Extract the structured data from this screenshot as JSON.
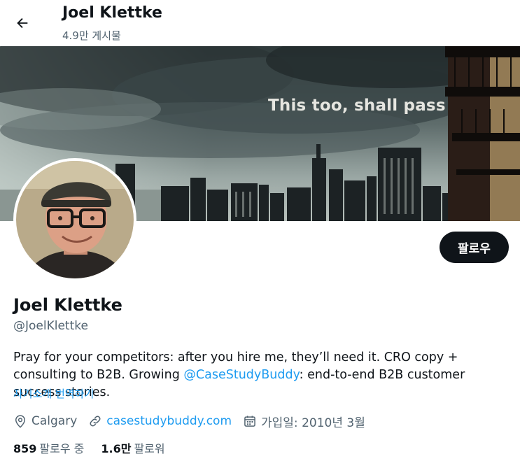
{
  "header": {
    "title": "Joel Klettke",
    "post_count": "4.9만 게시물",
    "back_icon": "arrow-left-icon"
  },
  "banner": {
    "text": "This too, shall pass"
  },
  "profile": {
    "name": "Joel Klettke",
    "handle": "@JoelKlettke",
    "follow_label": "팔로우",
    "bio_before": "Pray for your competitors: after you hire me, they’ll need it. CRO copy + consulting to B2B. Growing ",
    "bio_mention": "@CaseStudyBuddy",
    "bio_after": ": end-to-end B2B customer success stories.",
    "translate_label": "자기소개 번역하기",
    "location": "Calgary",
    "website": "casestudybuddy.com",
    "joined": "가입일: 2010년 3월",
    "following_count": "859",
    "following_label": "팔로우 중",
    "followers_count": "1.6만",
    "followers_label": "팔로워"
  },
  "icons": [
    "arrow-left-icon",
    "location-pin-icon",
    "link-icon",
    "calendar-icon"
  ],
  "colors": {
    "accent": "#1d9bf0",
    "text_primary": "#0f1419",
    "text_secondary": "#536471",
    "button_bg": "#0f1419"
  }
}
